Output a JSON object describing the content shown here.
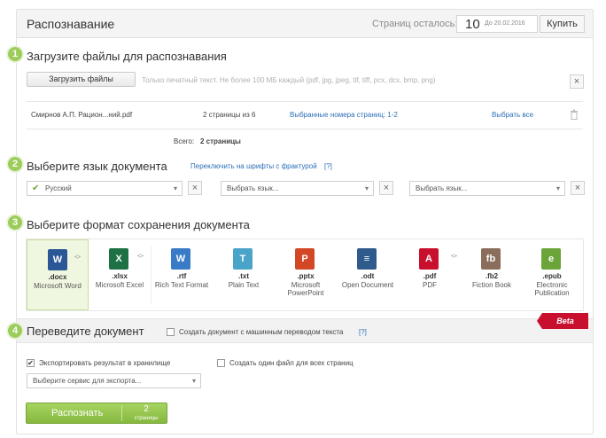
{
  "header": {
    "title": "Распознавание",
    "pages_left_label": "Страниц осталось:",
    "pages_left": "10",
    "until_date": "До 20.02.2016",
    "buy_label": "Купить"
  },
  "step1": {
    "number": "1",
    "title": "Загрузите файлы для распознавания",
    "upload_label": "Загрузить файлы",
    "hint": "Только печатный текст. Не более 100 МБ каждый (pdf, jpg, jpeg, tif, tiff, pcx, dcx, bmp, png)",
    "close": "×",
    "file": {
      "name": "Смирнов А.П. Рацион...ний.pdf",
      "pages": "2 страницы из 6",
      "selected_pages_link": "Выбранные номера страниц: 1-2",
      "select_all_link": "Выбрать все",
      "trash_icon": "trash-icon"
    },
    "total_label": "Всего:",
    "total_value": "2 страницы"
  },
  "step2": {
    "number": "2",
    "title": "Выберите язык документа",
    "fraktur_link": "Переключить на шрифты с фрактурой",
    "help": "[?]",
    "lang1": "Русский",
    "lang2_placeholder": "Выбрать язык...",
    "lang3_placeholder": "Выбрать язык...",
    "remove": "×"
  },
  "step3": {
    "number": "3",
    "title": "Выберите формат сохранения документа",
    "formats": [
      {
        "ext": ".docx",
        "name": "Microsoft Word",
        "icon": "W",
        "color": "#2b5797"
      },
      {
        "ext": ".xlsx",
        "name": "Microsoft Excel",
        "icon": "X",
        "color": "#1e7145"
      },
      {
        "ext": ".rtf",
        "name": "Rich Text Format",
        "icon": "W",
        "color": "#3a7bc8"
      },
      {
        "ext": ".txt",
        "name": "Plain Text",
        "icon": "T",
        "color": "#4aa3c8"
      },
      {
        "ext": ".pptx",
        "name": "Microsoft PowerPoint",
        "icon": "P",
        "color": "#d24726"
      },
      {
        "ext": ".odt",
        "name": "Open Document",
        "icon": "≡",
        "color": "#2f5b8c"
      },
      {
        "ext": ".pdf",
        "name": "PDF",
        "icon": "A",
        "color": "#c8102e"
      },
      {
        "ext": ".fb2",
        "name": "Fiction Book",
        "icon": "fb",
        "color": "#8a6d5a"
      },
      {
        "ext": ".epub",
        "name": "Electronic Publication",
        "icon": "e",
        "color": "#6ba539"
      }
    ]
  },
  "step4": {
    "number": "4",
    "title": "Переведите документ",
    "machine_translation_label": "Создать документ с машинным переводом текста",
    "help": "[?]",
    "beta": "Beta"
  },
  "export": {
    "export_label": "Экспортировать результат в хранилище",
    "single_file_label": "Создать один файл для всех страниц",
    "service_placeholder": "Выберите сервис для экспорта...",
    "export_checked": "✔"
  },
  "recognize": {
    "label": "Распознать",
    "count": "2",
    "count_unit": "страницы"
  }
}
